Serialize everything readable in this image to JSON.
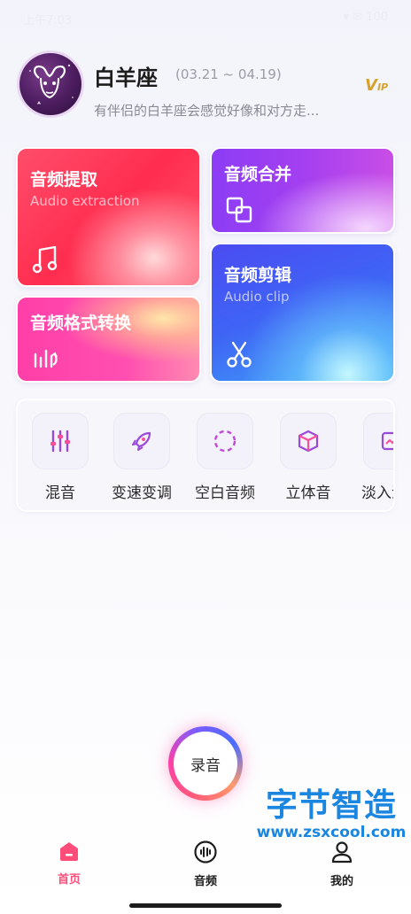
{
  "status_bar": {
    "time": "上午7:03",
    "right": "▾ ✉ 100"
  },
  "header": {
    "name": "白羊座",
    "date_range": "(03.21 ~ 04.19)",
    "description": "有伴侣的白羊座会感觉好像和对方走...",
    "vip_label": "V",
    "vip_small": "IP"
  },
  "cards": {
    "extract": {
      "title": "音频提取",
      "subtitle": "Audio extraction",
      "icon": "music-note-icon"
    },
    "merge": {
      "title": "音频合并",
      "icon": "merge-squares-icon"
    },
    "format": {
      "title": "音频格式转换",
      "icon": "convert-wave-icon"
    },
    "clip": {
      "title": "音频剪辑",
      "subtitle": "Audio clip",
      "icon": "scissors-icon"
    }
  },
  "tools": [
    {
      "label": "混音",
      "icon": "sliders-icon"
    },
    {
      "label": "变速变调",
      "icon": "rocket-icon"
    },
    {
      "label": "空白音频",
      "icon": "dashed-circle-icon"
    },
    {
      "label": "立体音",
      "icon": "cube-icon"
    },
    {
      "label": "淡入淡出",
      "icon": "fade-icon"
    }
  ],
  "record_button": {
    "label": "录音"
  },
  "watermark": {
    "title": "字节智造",
    "url": "www.zsxcool.com"
  },
  "bottom_nav": [
    {
      "label": "首页",
      "icon": "home-icon",
      "active": true
    },
    {
      "label": "音频",
      "icon": "audio-wave-icon",
      "active": false
    },
    {
      "label": "我的",
      "icon": "user-icon",
      "active": false
    }
  ],
  "colors": {
    "accent": "#ff4d7a",
    "tool_icon": "#9a4ad8",
    "watermark": "#1a86e0"
  }
}
